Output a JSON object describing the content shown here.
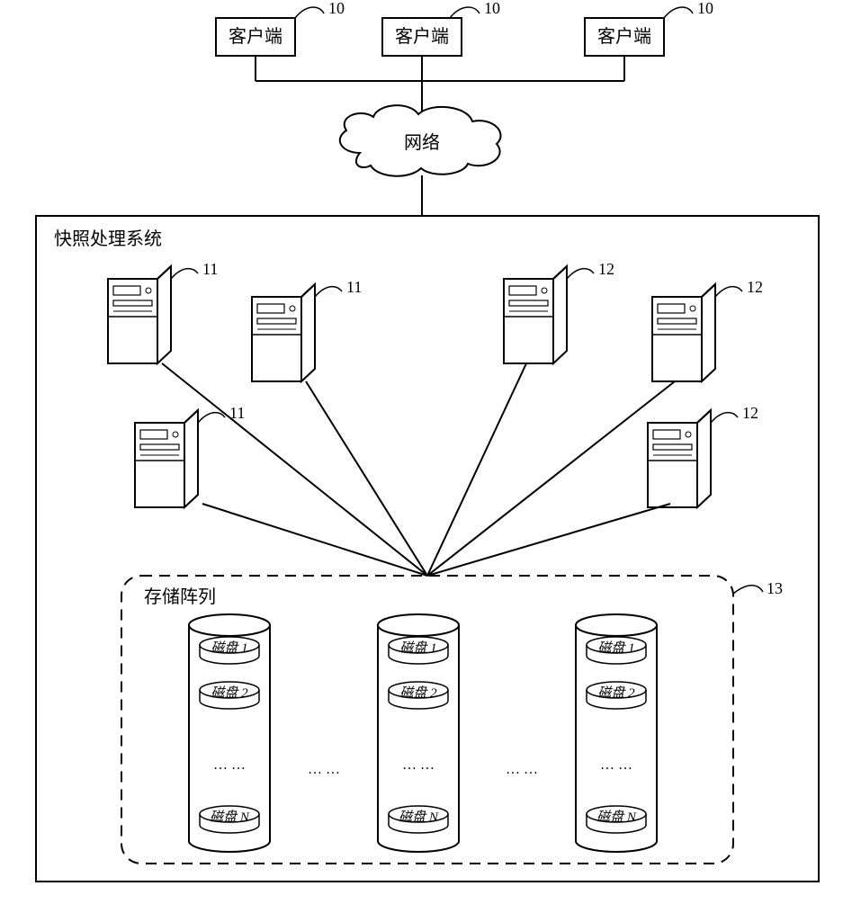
{
  "labels": {
    "client": "客户端",
    "client_ref": "10",
    "network": "网络",
    "system_title": "快照处理系统",
    "server_left_ref": "11",
    "server_right_ref": "12",
    "storage_title": "存储阵列",
    "storage_ref": "13",
    "disk1": "磁盘 1",
    "disk2": "磁盘 2",
    "diskN": "磁盘 N",
    "ellipsis": "… …"
  }
}
